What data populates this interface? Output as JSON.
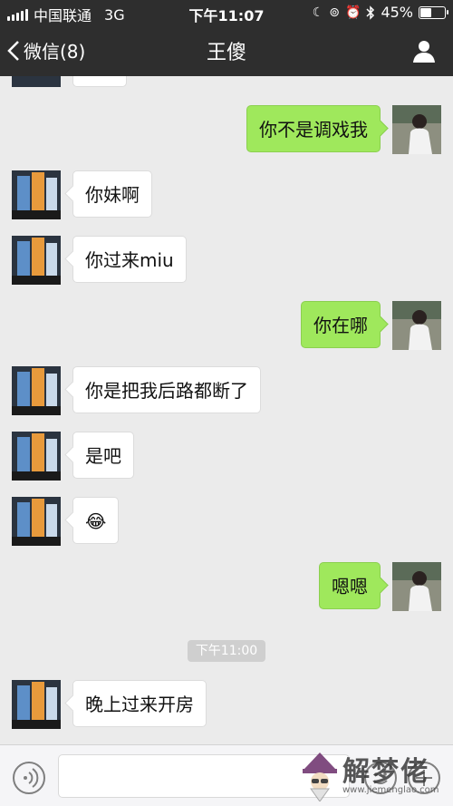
{
  "status_bar": {
    "carrier": "中国联通",
    "network": "3G",
    "time": "下午11:07",
    "battery": "45%",
    "battery_level": 0.45
  },
  "nav": {
    "back_label": "微信(8)",
    "title": "王傻"
  },
  "messages": [
    {
      "side": "left",
      "text": ""
    },
    {
      "side": "right",
      "text": "你不是调戏我"
    },
    {
      "side": "left",
      "text": "你妹啊"
    },
    {
      "side": "left",
      "text": "你过来miu"
    },
    {
      "side": "right",
      "text": "你在哪"
    },
    {
      "side": "left",
      "text": "你是把我后路都断了"
    },
    {
      "side": "left",
      "text": "是吧"
    },
    {
      "side": "left",
      "text": "😂"
    },
    {
      "side": "right",
      "text": "嗯嗯"
    },
    {
      "side": "left",
      "text": "晚上过来开房"
    }
  ],
  "timestamp": "下午11:00",
  "input": {
    "value": "",
    "placeholder": ""
  },
  "watermark": {
    "text": "解梦佬",
    "url": "www.jiemenglao.com"
  },
  "colors": {
    "bar_background": "#2e2e2e",
    "chat_background": "#ebebeb",
    "sent_bubble": "#9fe85c",
    "received_bubble": "#ffffff"
  }
}
